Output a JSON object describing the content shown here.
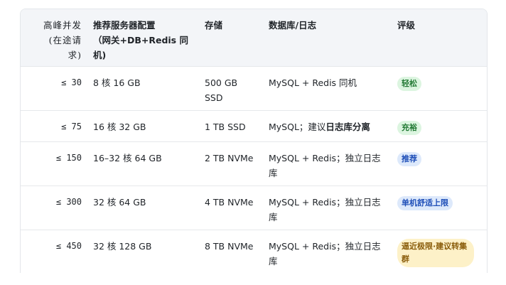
{
  "headers": {
    "load": [
      "高峰并发",
      "(在途请",
      "求)"
    ],
    "server": [
      "推荐服务器配置",
      "（网关+DB+Redis 同",
      "机)"
    ],
    "storage": "存储",
    "database": "数据库/日志",
    "rating": "评级"
  },
  "rows": [
    {
      "load": "≤ 30",
      "server": "8 核 16 GB",
      "storage": "500 GB SSD",
      "db_pre": "MySQL + Redis 同机",
      "db_bold": "",
      "rating": "轻松",
      "rating_color": "green"
    },
    {
      "load": "≤ 75",
      "server": "16 核 32 GB",
      "storage": "1 TB SSD",
      "db_pre": "MySQL；建议",
      "db_bold": "日志库分离",
      "rating": "充裕",
      "rating_color": "green"
    },
    {
      "load": "≤ 150",
      "server": "16–32 核 64 GB",
      "storage": "2 TB NVMe",
      "db_pre": "MySQL + Redis；独立日志库",
      "db_bold": "",
      "rating": "推荐",
      "rating_color": "blue"
    },
    {
      "load": "≤ 300",
      "server": "32 核 64 GB",
      "storage": "4 TB NVMe",
      "db_pre": "MySQL + Redis；独立日志库",
      "db_bold": "",
      "rating": "单机舒适上限",
      "rating_color": "blue"
    },
    {
      "load": "≤ 450",
      "server": "32 核 128 GB",
      "storage": "8 TB NVMe",
      "db_pre": "MySQL + Redis；独立日志库",
      "db_bold": "",
      "rating": "逼近极限·建议转集群",
      "rating_color": "amber"
    }
  ]
}
